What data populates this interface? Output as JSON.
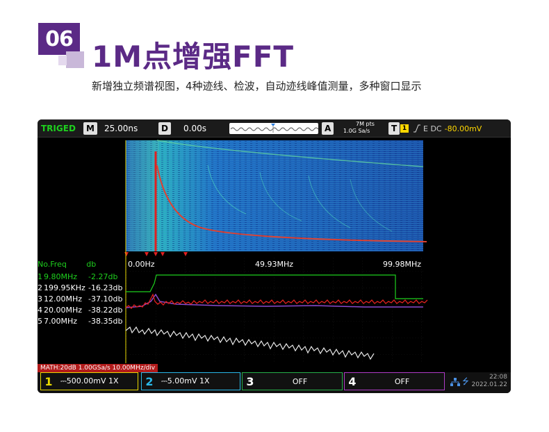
{
  "header": {
    "badge": "06",
    "title": "1M点增强FFT",
    "subtitle": "新增独立频谱视图，4种迹线、检波，自动迹线峰值测量，多种窗口显示"
  },
  "scope": {
    "trigger_status": "TRIGED",
    "timebase_key": "M",
    "timebase_value": "25.00ns",
    "delay_key": "D",
    "delay_value": "0.00s",
    "acq_key": "A",
    "acq_points": "7M pts",
    "acq_rate": "1.0G Sa/s",
    "trigger_key": "T",
    "trigger_channel": "1",
    "trigger_spec": "E DC",
    "trigger_level": "-80.00mV",
    "freq_start": "0.00Hz",
    "freq_center": "49.93MHz",
    "freq_stop": "99.98MHz",
    "peaks_header": {
      "no": "No.",
      "freq": "Freq",
      "db": "db"
    },
    "peaks": [
      {
        "no": "1",
        "freq": "9.80MHz",
        "db": "-2.27db"
      },
      {
        "no": "2",
        "freq": "199.95KHz",
        "db": "-16.23db"
      },
      {
        "no": "3",
        "freq": "12.00MHz",
        "db": "-37.10db"
      },
      {
        "no": "4",
        "freq": "20.00MHz",
        "db": "-38.22db"
      },
      {
        "no": "5",
        "freq": "7.00MHz",
        "db": "-38.35db"
      }
    ],
    "math_bar": "MATH:20dB  1.00GSa/s  10.00MHz/div",
    "channels": [
      {
        "num": "1",
        "text": "⎓500.00mV  1X"
      },
      {
        "num": "2",
        "text": "⎓5.00mV  1X"
      },
      {
        "num": "3",
        "text": "OFF"
      },
      {
        "num": "4",
        "text": "OFF"
      }
    ],
    "time": "22:08",
    "date": "2022.01.22"
  },
  "colors": {
    "brand_purple": "#5b2a86",
    "ch1": "#e8d800",
    "ch2": "#2ab8e8",
    "ch3": "#26b04a",
    "ch4": "#b03cc8",
    "trace_red": "#e0201e",
    "trace_green": "#1ed01e"
  }
}
